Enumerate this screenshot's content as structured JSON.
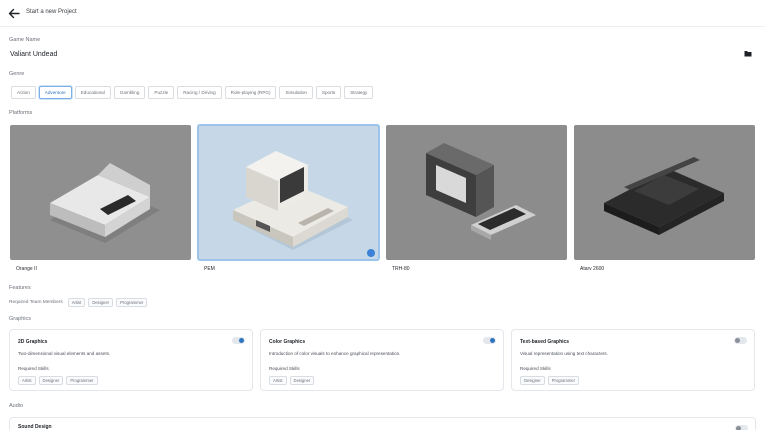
{
  "header": {
    "title": "Start a new Project"
  },
  "game_name": {
    "label": "Game Name",
    "value": "Valiant Undead"
  },
  "genre": {
    "label": "Genre",
    "options": [
      "Action",
      "Adventure",
      "Educational",
      "Gambling",
      "Puzzle",
      "Racing / Driving",
      "Role-playing (RPG)",
      "Simulation",
      "Sports",
      "Strategy"
    ],
    "selected": "Adventure"
  },
  "platforms": {
    "label": "Platforms",
    "items": [
      {
        "name": "Orange II"
      },
      {
        "name": "PEM"
      },
      {
        "name": "TRH-80"
      },
      {
        "name": "Atarv 2600"
      }
    ],
    "selected": "PEM"
  },
  "features": {
    "label": "Features",
    "required_label": "Required Team Members",
    "required_members": [
      "Artist",
      "Designer",
      "Programmer"
    ]
  },
  "graphics": {
    "label": "Graphics",
    "cards": [
      {
        "title": "2D Graphics",
        "description": "Two-dimensional visual elements and assets.",
        "skills_label": "Required Skills",
        "skills": [
          "Artist",
          "Designer",
          "Programmer"
        ],
        "enabled": true
      },
      {
        "title": "Color Graphics",
        "description": "Introduction of color visuals to enhance graphical representation.",
        "skills_label": "Required Skills",
        "skills": [
          "Artist",
          "Designer"
        ],
        "enabled": true
      },
      {
        "title": "Text-based Graphics",
        "description": "Visual representation using text characters.",
        "skills_label": "Required Skills",
        "skills": [
          "Designer",
          "Programmer"
        ],
        "enabled": false
      }
    ]
  },
  "audio": {
    "label": "Audio",
    "cards": [
      {
        "title": "Sound Design",
        "enabled": false
      }
    ]
  },
  "colors": {
    "accent": "#2f74c0",
    "selected_border": "#9cc4ea",
    "border": "#e3e6ea"
  }
}
